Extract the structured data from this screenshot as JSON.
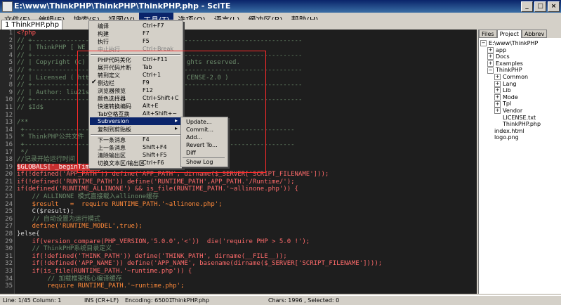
{
  "window": {
    "title": "E:\\www\\ThinkPHP\\ThinkPHP\\ThinkPHP.php - SciTE"
  },
  "menu": [
    "文件(F)",
    "编辑(E)",
    "搜索(S)",
    "视图(V)",
    "工具(T)",
    "选项(O)",
    "语言(L)",
    "缓冲区(B)",
    "帮助(H)"
  ],
  "tab": {
    "label": "1 ThinkPHP.php"
  },
  "dropdown": {
    "items": [
      {
        "label": "编译",
        "acc": "Ctrl+F7"
      },
      {
        "label": "构建",
        "acc": "F7"
      },
      {
        "label": "执行",
        "acc": "F5"
      },
      {
        "label": "中止执行",
        "acc": "Ctrl+Break"
      },
      {
        "label": "PHP代码美化",
        "acc": "Ctrl+F11"
      },
      {
        "label": "展开代码片断",
        "acc": "Tab"
      },
      {
        "label": "转到定义",
        "acc": "Ctrl+1"
      },
      {
        "label": "侧边栏",
        "acc": "F9"
      },
      {
        "label": "浏览器预览",
        "acc": "F12"
      },
      {
        "label": "颜色选择器",
        "acc": "Ctrl+Shift+C"
      },
      {
        "label": "快速转换编码",
        "acc": "Alt+E"
      },
      {
        "label": "Tab空格互换",
        "acc": "Alt+Shift+~"
      },
      {
        "label": "Subversion",
        "acc": ""
      },
      {
        "label": "复制到剪贴板",
        "acc": ""
      },
      {
        "label": "下一条消息",
        "acc": "F4"
      },
      {
        "label": "上一条消息",
        "acc": "Shift+F4"
      },
      {
        "label": "清除输出区",
        "acc": "Shift+F5"
      },
      {
        "label": "切换文本区/输出区",
        "acc": "Ctrl+F6"
      }
    ]
  },
  "submenu": [
    "Update...",
    "Commit...",
    "Add...",
    "Revert To...",
    "Diff",
    "Show Log"
  ],
  "right_tabs": [
    "Files",
    "Project",
    "Abbrev"
  ],
  "tree": {
    "root": "E:\\www\\ThinkPHP",
    "children": [
      "app",
      "Docs",
      "Examples",
      "ThinkPHP"
    ],
    "thinkphp_children": [
      "Common",
      "Lang",
      "Lib",
      "Mode",
      "Tpl",
      "Vendor",
      "LICENSE.txt",
      "ThinkPHP.php"
    ],
    "tail": [
      "index.html",
      "logo.png"
    ]
  },
  "status": {
    "line": "Line: 1/45  Column: 1",
    "ins": "INS (CR+LF)",
    "encoding": "Encoding: 65001",
    "file": "ThinkPHP.php",
    "chars": "Chars: 1996 , Selected: 0"
  },
  "code": {
    "line_numbers": [
      "1",
      "2",
      "3",
      "4",
      "5",
      "6",
      "7",
      "8",
      "9",
      "10",
      "11",
      "12",
      "13",
      "14",
      "15",
      "16",
      "17",
      "18",
      "19",
      "20",
      "21",
      "22",
      "23",
      "24",
      "25",
      "26",
      "27",
      "28",
      "29",
      "30",
      "31",
      "32",
      "33",
      "34",
      "35"
    ],
    "l1": "<?php",
    "l2": "// +-----------------------------------------------------------------------",
    "l3": "// | ThinkPHP [ WE CAN",
    "l4": "// +-----------------------------------------------------------------------",
    "l5a": "// | Copyright (c) 200",
    "l5b": "ghts reserved.",
    "l6": "// +-----------------------------------------------------------------------",
    "l7a": "// | Licensed ( http:",
    "l7b": "CENSE-2.0 )",
    "l8": "// +-----------------------------------------------------------------------",
    "l9": "// | Author: liu21st <",
    "l10": "// +-----------------------------------------------------------------------",
    "l11": "// $Id$",
    "l13": "/**",
    "l14": " +-----------------------------------------------------------------------",
    "l15": " * ThinkPHP公共文件",
    "l16": " +-----------------------------------------------------------------------",
    "l17": " */",
    "l18": "//记录开始运行时间",
    "l19a": "$GLOBALS['_beginTime']",
    "l19b": " = microtime(TRUE);",
    "l20a": "if(!defined('APP_PATH')) define('APP_PATH', dirname($_SERVER['SCRIPT_FILENAME']));",
    "l21": "if(!defined('RUNTIME_PATH')) define('RUNTIME_PATH',APP_PATH.'/Runtime/');",
    "l22": "if(defined('RUNTIME_ALLINONE') && is_file(RUNTIME_PATH.'~allinone.php')) {",
    "l23": "    // ALLINONE 模式直接载入allinone缓存",
    "l24": "    $result   =  require RUNTIME_PATH.'~allinone.php';",
    "l25": "    C($result);",
    "l26": "    // 自动设置为运行模式",
    "l27": "    define('RUNTIME_MODEL',true);",
    "l28": "}else{",
    "l29": "    if(version_compare(PHP_VERSION,'5.0.0','<'))  die('require PHP > 5.0 !');",
    "l30": "    // ThinkPHP系统目录定义",
    "l31": "    if(!defined('THINK_PATH')) define('THINK_PATH', dirname(__FILE__));",
    "l32": "    if(!defined('APP_NAME')) define('APP_NAME', basename(dirname($_SERVER['SCRIPT_FILENAME'])));",
    "l33": "    if(is_file(RUNTIME_PATH.'~runtime.php')) {",
    "l34": "        // 加载框架核心编译缓存",
    "l35": "        require RUNTIME_PATH.'~runtime.php';"
  }
}
